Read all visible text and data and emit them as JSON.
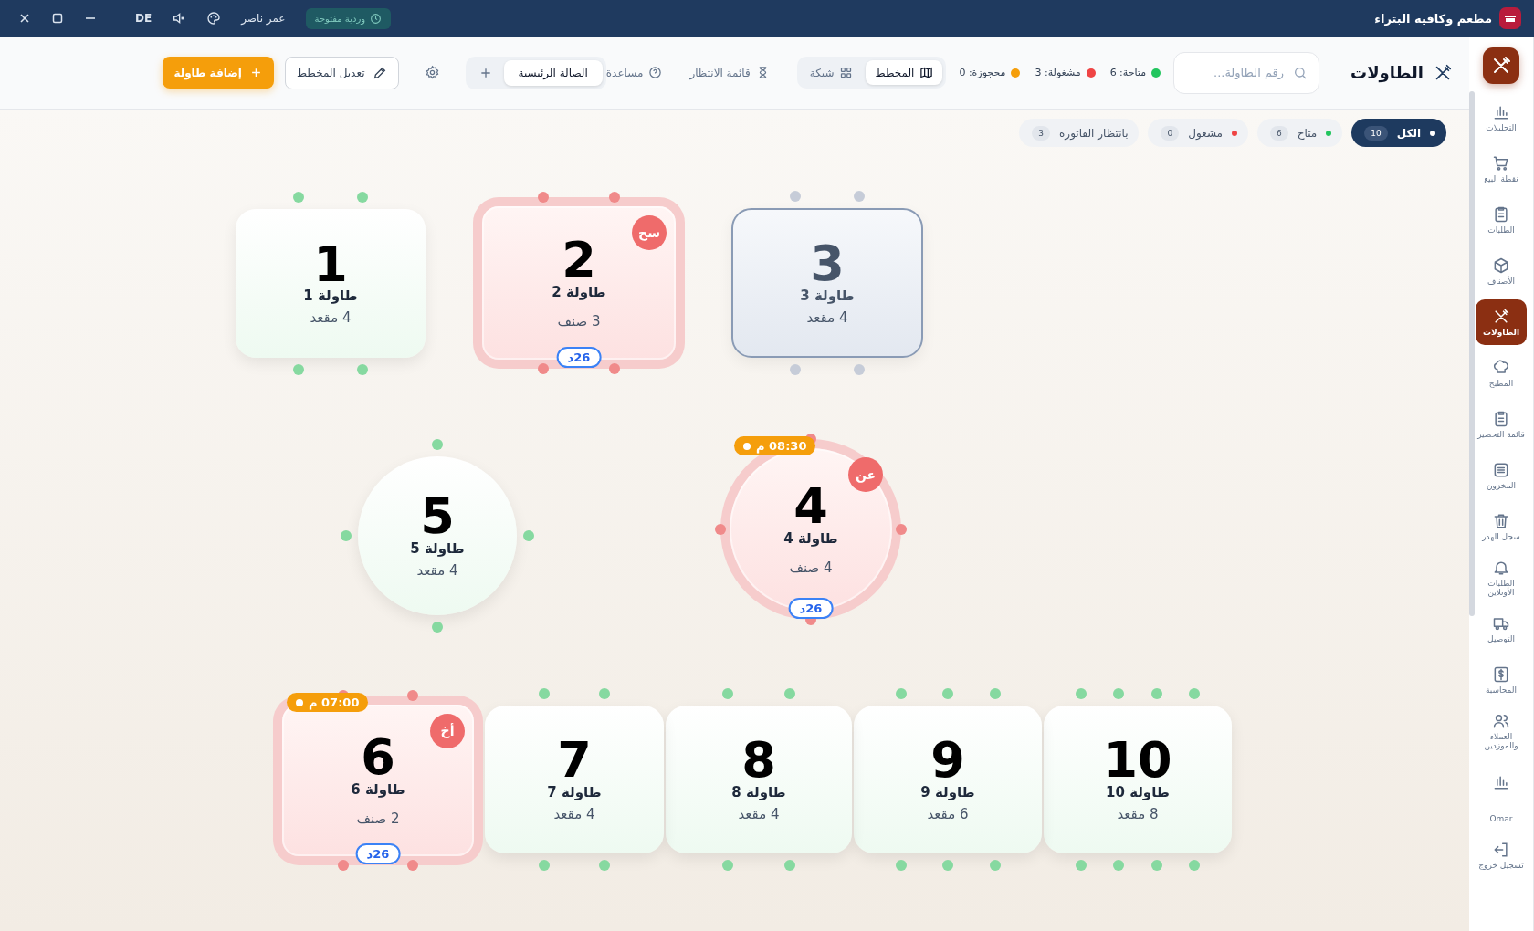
{
  "title_bar": {
    "app_name": "مطعم وكافيه البتراء",
    "shift_badge": "وردية مفتوحة",
    "user": "عمر ناصر",
    "language": "DE"
  },
  "sidebar": {
    "items": [
      {
        "label": "التحليلات",
        "kind": "chart",
        "selected": false
      },
      {
        "label": "نقطة البيع",
        "kind": "cart",
        "selected": false
      },
      {
        "label": "الطلبات",
        "kind": "clipboard",
        "selected": false
      },
      {
        "label": "الأصناف",
        "kind": "box",
        "selected": false
      },
      {
        "label": "الطاولات",
        "kind": "utensils",
        "selected": true
      },
      {
        "label": "المطبخ",
        "kind": "chef",
        "selected": false
      },
      {
        "label": "قائمة التحضير",
        "kind": "clipboard",
        "selected": false
      },
      {
        "label": "المخزون",
        "kind": "archive",
        "selected": false
      },
      {
        "label": "سجل الهدر",
        "kind": "trash",
        "selected": false
      },
      {
        "label": "الطلبات الأونلاين",
        "kind": "bell",
        "selected": false
      },
      {
        "label": "التوصيل",
        "kind": "truck",
        "selected": false
      },
      {
        "label": "المحاسبة",
        "kind": "dollar",
        "selected": false
      },
      {
        "label": "العملاء والموزدين",
        "kind": "users",
        "selected": false
      },
      {
        "kind": "chart",
        "selected": false
      }
    ],
    "user": "Omar",
    "logout": "تسجيل خروج"
  },
  "header": {
    "title": "الطاولات",
    "search": {
      "placeholder": "رقم الطاولة..."
    },
    "legend": [
      {
        "label": "متاحة: 6",
        "color": "#22c55e"
      },
      {
        "label": "مشغولة: 3",
        "color": "#ef4444"
      },
      {
        "label": "محجوزة: 0",
        "color": "#f59e0b"
      }
    ],
    "views": [
      {
        "label": "المخطط",
        "kind": "map",
        "selected": true
      },
      {
        "label": "شبكة",
        "kind": "grid",
        "selected": false
      }
    ],
    "waitlist": "قائمة الانتظار",
    "help": "مساعدة",
    "floors": [
      {
        "label": "الصالة الرئيسية",
        "selected": true
      }
    ],
    "edit_layout": "تعديل المخطط",
    "add_table": "إضافة طاولة"
  },
  "filters": [
    {
      "label": "الكل",
      "count": "10",
      "selected": true,
      "color": "#ffffff"
    },
    {
      "label": "متاح",
      "count": "6",
      "selected": false,
      "color": "#22c55e"
    },
    {
      "label": "مشغول",
      "count": "0",
      "selected": false,
      "color": "#ef4444"
    },
    {
      "label": "بانتظار الفاتورة",
      "count": "3",
      "selected": false
    }
  ],
  "tables": [
    {
      "number": "3",
      "label": "طاولة 3",
      "detail": "4 مقعد",
      "kind": "rect",
      "occupied": false,
      "disabled": true
    },
    {
      "number": "2",
      "label": "طاولة 2",
      "detail": "3 صنف",
      "kind": "rect",
      "occupied": true,
      "disabled": false,
      "initials": "سح",
      "duration": "26د"
    },
    {
      "number": "1",
      "label": "طاولة 1",
      "detail": "4 مقعد",
      "kind": "rect",
      "occupied": false,
      "disabled": false
    },
    {
      "number": "4",
      "label": "طاولة 4",
      "detail": "4 صنف",
      "kind": "circle",
      "occupied": true,
      "disabled": false,
      "initials": "عن",
      "duration": "26د",
      "reservation": "08:30 م"
    },
    {
      "number": "5",
      "label": "طاولة 5",
      "detail": "4 مقعد",
      "kind": "circle",
      "occupied": false,
      "disabled": false
    },
    {
      "number": "10",
      "label": "طاولة 10",
      "detail": "8 مقعد",
      "kind": "rect",
      "occupied": false,
      "disabled": false
    },
    {
      "number": "9",
      "label": "طاولة 9",
      "detail": "6 مقعد",
      "kind": "rect",
      "occupied": false,
      "disabled": false
    },
    {
      "number": "8",
      "label": "طاولة 8",
      "detail": "4 مقعد",
      "kind": "rect",
      "occupied": false,
      "disabled": false
    },
    {
      "number": "7",
      "label": "طاولة 7",
      "detail": "4 مقعد",
      "kind": "rect",
      "occupied": false,
      "disabled": false
    },
    {
      "number": "6",
      "label": "طاولة 6",
      "detail": "2 صنف",
      "kind": "rect",
      "occupied": true,
      "disabled": false,
      "initials": "أخ",
      "duration": "26د",
      "reservation": "07:00 م"
    }
  ]
}
